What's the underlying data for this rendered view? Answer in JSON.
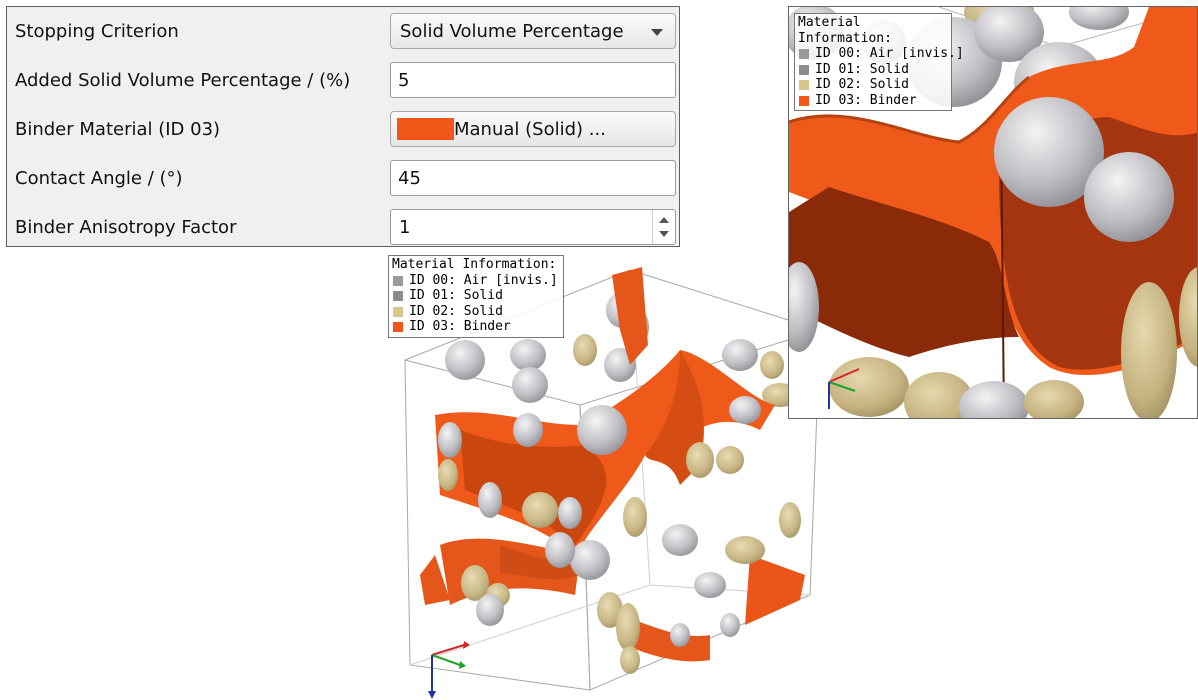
{
  "settings": {
    "stopping_criterion": {
      "label": "Stopping Criterion",
      "value": "Solid Volume Percentage"
    },
    "added_solid_volume": {
      "label": "Added Solid Volume Percentage / (%)",
      "value": "5"
    },
    "binder_material": {
      "label": "Binder Material (ID 03)",
      "value": "Manual (Solid) ...",
      "swatch_color": "#f05716"
    },
    "contact_angle": {
      "label": "Contact Angle / (°)",
      "value": "45"
    },
    "anisotropy": {
      "label": "Binder Anisotropy Factor",
      "value": "1"
    }
  },
  "legend": {
    "title": "Material Information:",
    "items": [
      {
        "label": "ID 00: Air [invis.]",
        "color": "#9a9a9a"
      },
      {
        "label": "ID 01: Solid",
        "color": "#8c8c8c"
      },
      {
        "label": "ID 02: Solid",
        "color": "#d9c48a"
      },
      {
        "label": "ID 03: Binder",
        "color": "#f05716"
      }
    ]
  },
  "colors": {
    "binder": "#f05716",
    "solid_gray": "#c8c8cc",
    "solid_tan": "#c9b987",
    "panel_bg": "#f0f0f0"
  },
  "icons": [
    "dropdown-arrow-icon",
    "spin-up-icon",
    "spin-down-icon",
    "axis-triad-icon",
    "material-cube-icon"
  ]
}
